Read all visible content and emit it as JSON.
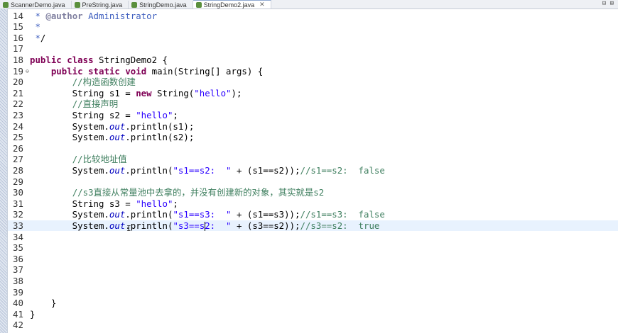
{
  "tabs": [
    {
      "label": "ScannerDemo.java",
      "active": false
    },
    {
      "label": "PreString.java",
      "active": false
    },
    {
      "label": "StringDemo.java",
      "active": false
    },
    {
      "label": "StringDemo2.java",
      "active": true
    }
  ],
  "tab_close_glyph": "✕",
  "window_controls": "⊟ ⊞",
  "lines": [
    {
      "n": "14",
      "code": " * @author Administrator"
    },
    {
      "n": "15",
      "code": " *"
    },
    {
      "n": "16",
      "code": " */"
    },
    {
      "n": "17",
      "code": ""
    },
    {
      "n": "18",
      "code": "public class StringDemo2 {"
    },
    {
      "n": "19",
      "code": "    public static void main(String[] args) {"
    },
    {
      "n": "20",
      "code": "        //构造函数创建"
    },
    {
      "n": "21",
      "code": "        String s1 = new String(\"hello\");"
    },
    {
      "n": "22",
      "code": "        //直接声明"
    },
    {
      "n": "23",
      "code": "        String s2 = \"hello\";"
    },
    {
      "n": "24",
      "code": "        System.out.println(s1);"
    },
    {
      "n": "25",
      "code": "        System.out.println(s2);"
    },
    {
      "n": "26",
      "code": ""
    },
    {
      "n": "27",
      "code": "        //比较地址值"
    },
    {
      "n": "28",
      "code": "        System.out.println(\"s1==s2:  \" + (s1==s2));//s1==s2:  false"
    },
    {
      "n": "29",
      "code": ""
    },
    {
      "n": "30",
      "code": "        //s3直接从常量池中去拿的，并没有创建新的对象，其实就是s2"
    },
    {
      "n": "31",
      "code": "        String s3 = \"hello\";"
    },
    {
      "n": "32",
      "code": "        System.out.println(\"s1==s3:  \" + (s1==s3));//s1==s3:  false"
    },
    {
      "n": "33",
      "code": "        System.out.println(\"s3==s2:  \" + (s3==s2));//s3==s2:  true"
    },
    {
      "n": "34",
      "code": ""
    },
    {
      "n": "35",
      "code": ""
    },
    {
      "n": "36",
      "code": ""
    },
    {
      "n": "37",
      "code": ""
    },
    {
      "n": "38",
      "code": ""
    },
    {
      "n": "39",
      "code": ""
    },
    {
      "n": "40",
      "code": "    }"
    },
    {
      "n": "41",
      "code": "}"
    },
    {
      "n": "42",
      "code": ""
    }
  ],
  "current_line": "33",
  "fold_marker_line": "19",
  "fold_glyph": "⊖",
  "colors": {
    "keyword": "#7f0055",
    "string": "#2a00ff",
    "comment": "#3f7f5f",
    "field": "#0000c0",
    "current_line": "#e8f2fe"
  }
}
